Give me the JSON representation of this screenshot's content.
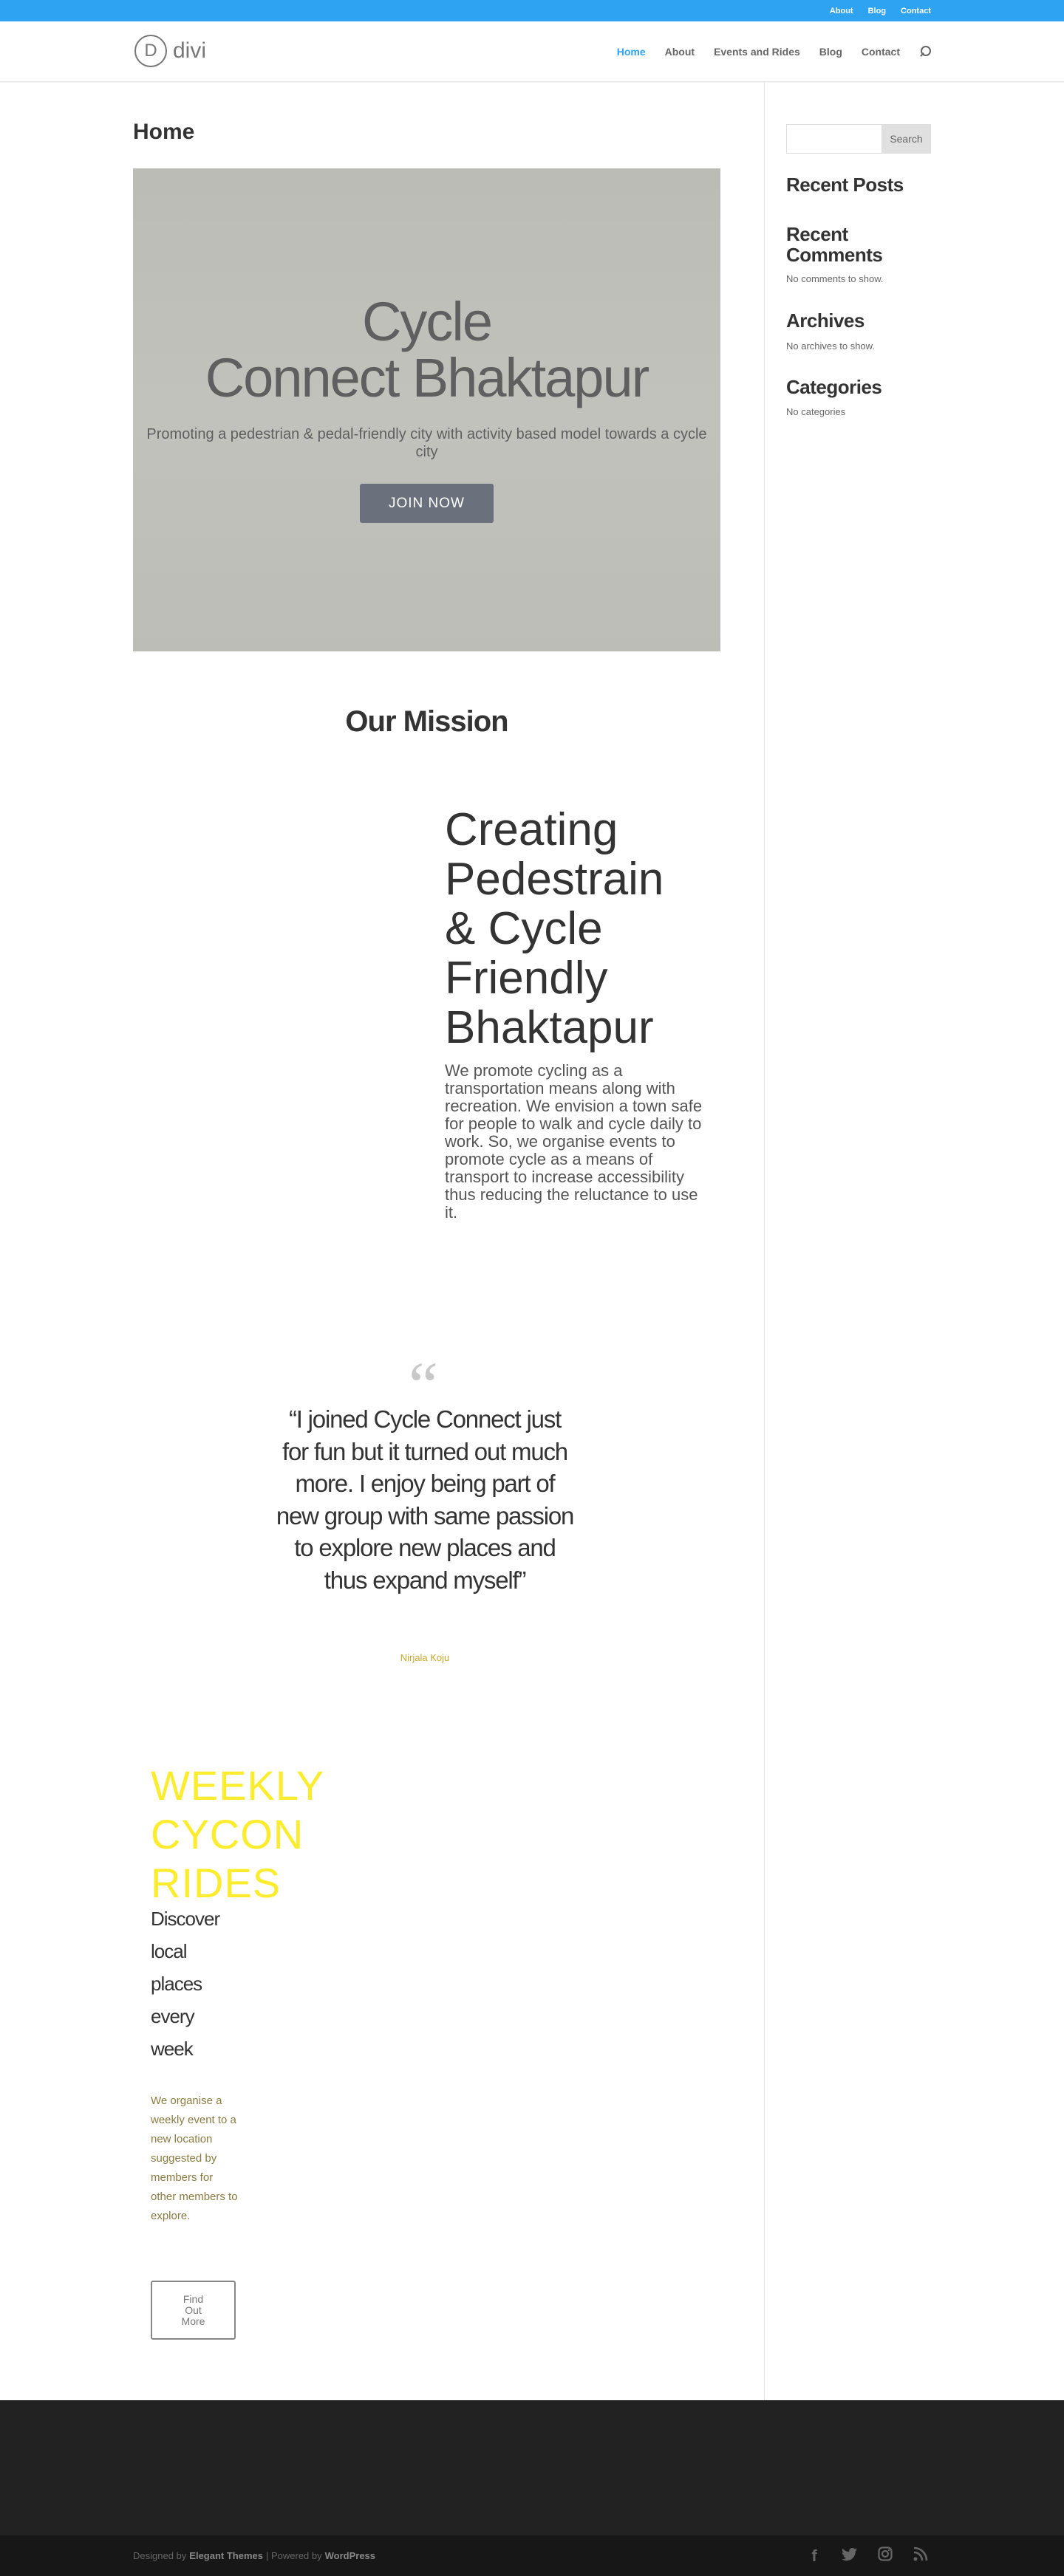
{
  "topbar": {
    "links": [
      "About",
      "Blog",
      "Contact"
    ],
    "color": "#2ea3f2"
  },
  "header": {
    "logo_mark": "D",
    "logo_text": "divi",
    "nav": [
      "Home",
      "About",
      "Events and Rides",
      "Blog",
      "Contact"
    ],
    "active_nav": "Home",
    "search_icon": "search-icon"
  },
  "page": {
    "title": "Home"
  },
  "hero": {
    "title_line1": "Cycle",
    "title_line2": "Connect Bhaktapur",
    "subtitle": "Promoting a pedestrian & pedal-friendly city with activity based model towards a cycle city",
    "button": "JOIN NOW"
  },
  "mission": {
    "title": "Our Mission",
    "heading_lines": [
      "Creating",
      "Pedestrain",
      "& Cycle",
      "Friendly",
      "Bhaktapur"
    ],
    "body": "We promote cycling as a transportation means along with recreation. We envision a town safe for people to walk and cycle daily to work. So, we organise events to promote cycle as a means of transport to increase accessibility thus reducing the reluctance to use it."
  },
  "testimonial": {
    "quote": "“I joined Cycle Connect just for fun but it turned out much more. I enjoy being part of new group with same passion to explore new places and thus expand myself”",
    "author": "Nirjala Koju"
  },
  "weekly": {
    "title_lines": [
      "WEEKLY",
      "CYCON",
      "RIDES"
    ],
    "sub_lines": [
      "Discover",
      "local",
      "places",
      "every",
      "week"
    ],
    "body": "We organise a weekly event to a new location suggested by members for other members to explore.",
    "button": "Find Out More",
    "accent": "#fbed2e"
  },
  "sidebar": {
    "search_placeholder": "",
    "search_button": "Search",
    "recent_posts": "Recent Posts",
    "recent_comments": "Recent Comments",
    "no_comments": "No comments to show.",
    "archives": "Archives",
    "no_archives": "No archives to show.",
    "categories": "Categories",
    "no_categories": "No categories"
  },
  "footer": {
    "designed_by": "Designed by",
    "elegant": "Elegant Themes",
    "separator": "| Powered by",
    "wordpress": "WordPress",
    "social_icons": [
      "facebook-icon",
      "twitter-icon",
      "instagram-icon",
      "rss-icon"
    ]
  }
}
